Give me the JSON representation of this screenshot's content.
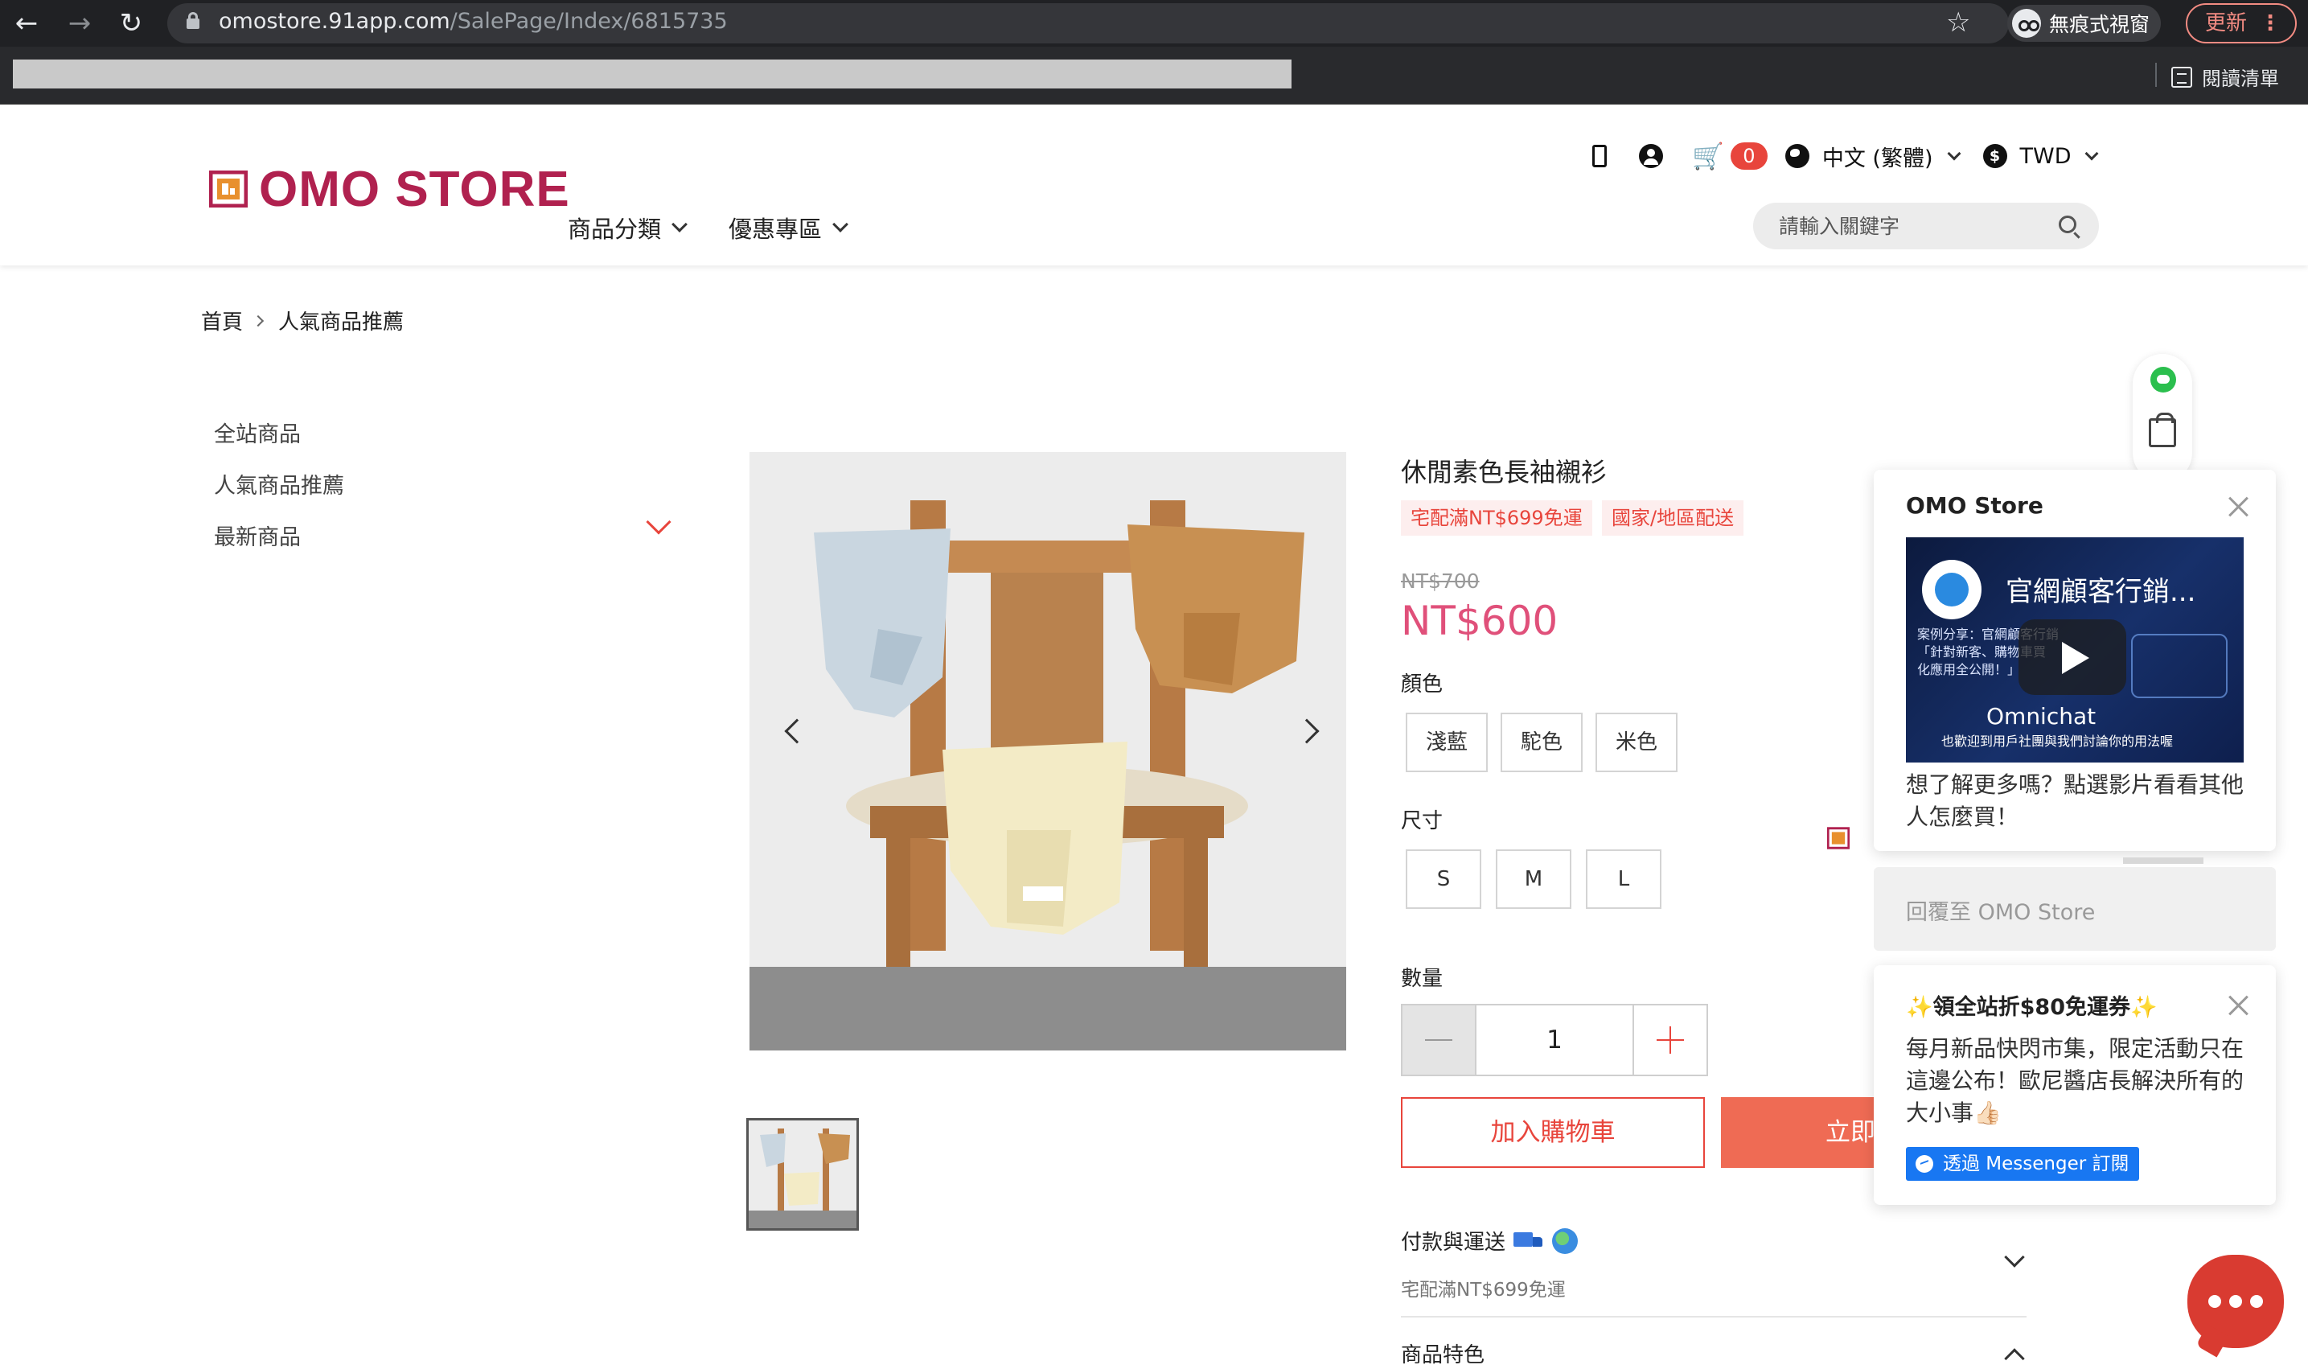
{
  "browser": {
    "url_host": "omostore.91app.com",
    "url_path": "/SalePage/Index/6815735",
    "incognito_label": "無痕式視窗",
    "update_label": "更新",
    "reading_list_label": "閱讀清單"
  },
  "header": {
    "logo_text": "OMO STORE",
    "nav": [
      "商品分類",
      "優惠專區"
    ],
    "cart_count": "0",
    "language": "中文 (繁體)",
    "currency_symbol": "$",
    "currency": "TWD",
    "search_placeholder": "請輸入關鍵字"
  },
  "breadcrumb": [
    "首頁",
    "人氣商品推薦"
  ],
  "sidebar": {
    "items": [
      "全站商品",
      "人氣商品推薦",
      "最新商品"
    ]
  },
  "product": {
    "title": "休閒素色長袖襯衫",
    "tags": [
      "宅配滿NT$699免運",
      "國家/地區配送"
    ],
    "original_price": "NT$700",
    "price": "NT$600",
    "color_label": "顏色",
    "colors": [
      "淺藍",
      "駝色",
      "米色"
    ],
    "size_label": "尺寸",
    "sizes": [
      "S",
      "M",
      "L"
    ],
    "qty_label": "數量",
    "qty": "1",
    "add_to_cart": "加入購物車",
    "buy_now": "立即購買",
    "payment_shipping": "付款與運送",
    "payment_shipping_sub": "宅配滿NT$699免運",
    "features": "商品特色"
  },
  "chat": {
    "name": "OMO Store",
    "video_title": "官網顧客行銷...",
    "video_sub1": "案例分享：官網顧客行銷",
    "video_sub2": "「針對新客、購物車買",
    "video_sub3": "化應用全公開！」",
    "video_brand": "Omnichat",
    "video_tagline": "也歡迎到用戶社團與我們討論你的用法喔",
    "message": "想了解更多嗎？點選影片看看其他人怎麼買！",
    "reply_placeholder": "回覆至 OMO Store"
  },
  "promo": {
    "title": "✨領全站折$80免運券✨",
    "message": "每月新品快閃市集，限定活動只在這邊公布！歐尼醬店長解決所有的大小事👍🏻",
    "button": "透過 Messenger 訂閱"
  },
  "colors": {
    "brand": "#b0214f",
    "accent": "#e8453c",
    "price": "#e0507a",
    "buy_now": "#ef6b54",
    "messenger": "#1877f2"
  }
}
